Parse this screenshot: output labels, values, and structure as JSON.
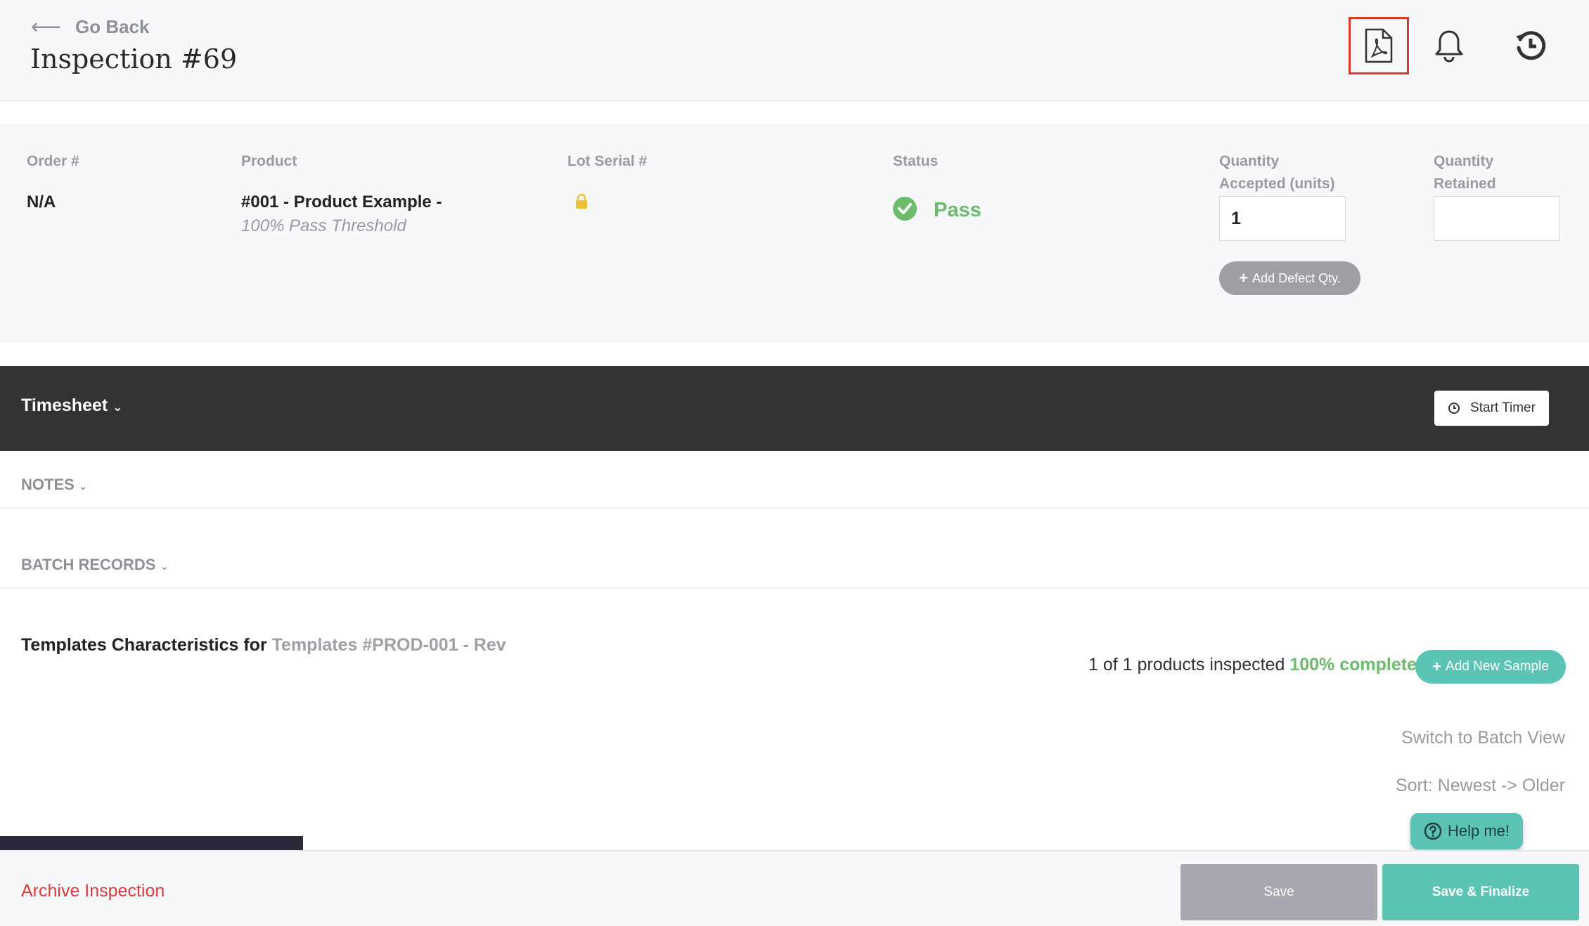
{
  "header": {
    "back_label": "Go Back",
    "title": "Inspection #69",
    "icons": [
      "pdf-icon",
      "bell-icon",
      "history-icon"
    ]
  },
  "summary": {
    "order": {
      "label": "Order #",
      "value": "N/A"
    },
    "product": {
      "label": "Product",
      "value": "#001 - Product Example -",
      "subtitle": "100% Pass Threshold"
    },
    "lot": {
      "label": "Lot Serial #",
      "icon": "lock-icon"
    },
    "status": {
      "label": "Status",
      "value": "Pass",
      "color": "#6dbb6d"
    },
    "qty_accepted": {
      "label_line1": "Quantity",
      "label_line2": "Accepted (units)",
      "value": "1"
    },
    "qty_retained": {
      "label_line1": "Quantity",
      "label_line2": "Retained",
      "value": ""
    },
    "add_defect_label": "Add Defect Qty."
  },
  "timesheet": {
    "title": "Timesheet",
    "start_timer_label": "Start Timer"
  },
  "sections": {
    "notes": "NOTES",
    "batch_records": "BATCH RECORDS"
  },
  "templates": {
    "prefix": "Templates Characteristics for",
    "name": "Templates #PROD-001 - Rev",
    "progress_text": "1 of 1 products inspected",
    "progress_complete": "100% complete",
    "add_sample_label": "Add New Sample",
    "switch_view_label": "Switch to Batch View",
    "sort_label": "Sort: Newest -> Older"
  },
  "help_label": "Help me!",
  "footer": {
    "archive_label": "Archive Inspection",
    "save_label": "Save",
    "finalize_label": "Save & Finalize"
  },
  "colors": {
    "accent": "#5bc4b5",
    "pass": "#6dbb6d",
    "danger": "#dc3c3c",
    "dark_bar": "#333333"
  }
}
